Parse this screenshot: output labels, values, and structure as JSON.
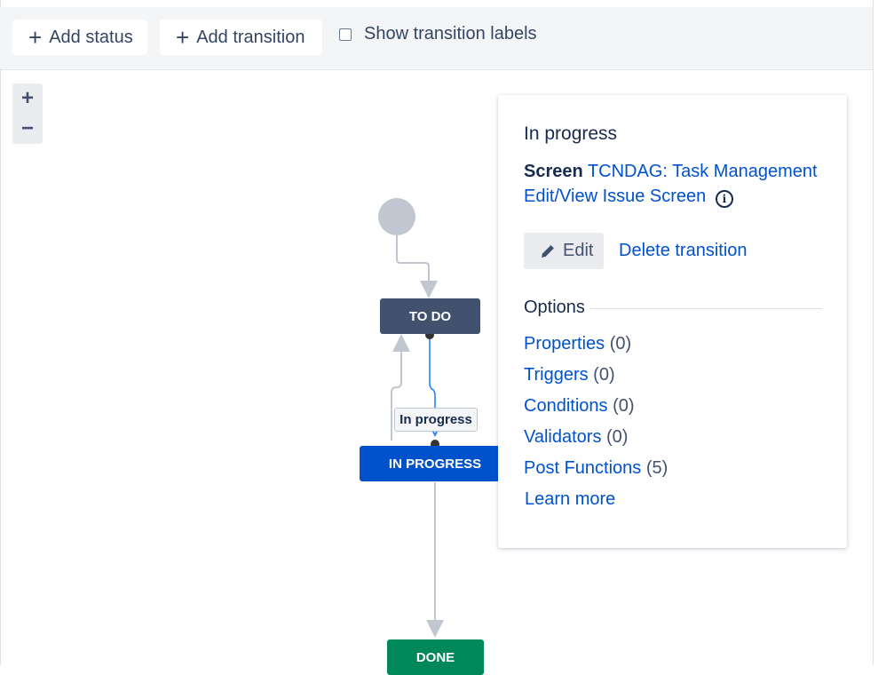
{
  "toolbar": {
    "add_status_label": "Add status",
    "add_transition_label": "Add transition",
    "show_labels_text": "Show transition labels",
    "show_labels_checked": false
  },
  "zoom": {
    "in": "+",
    "out": "−"
  },
  "diagram": {
    "statuses": [
      {
        "label": "TO DO",
        "color": "#42526e"
      },
      {
        "label": "IN PROGRESS",
        "color": "#0052cc"
      },
      {
        "label": "DONE",
        "color": "#00875a"
      }
    ],
    "selected_transition_label": "In progress"
  },
  "panel": {
    "title": "In progress",
    "screen_label": "Screen",
    "screen_link": "TCNDAG: Task Management Edit/View Issue Screen",
    "edit_label": "Edit",
    "delete_label": "Delete transition",
    "options_heading": "Options",
    "options": [
      {
        "label": "Properties",
        "count": "(0)"
      },
      {
        "label": "Triggers",
        "count": "(0)"
      },
      {
        "label": "Conditions",
        "count": "(0)"
      },
      {
        "label": "Validators",
        "count": "(0)"
      },
      {
        "label": "Post Functions",
        "count": "(5)"
      }
    ],
    "learn_more": "Learn more"
  },
  "colors": {
    "link": "#0052cc",
    "selected_transition": "#2684ff"
  }
}
